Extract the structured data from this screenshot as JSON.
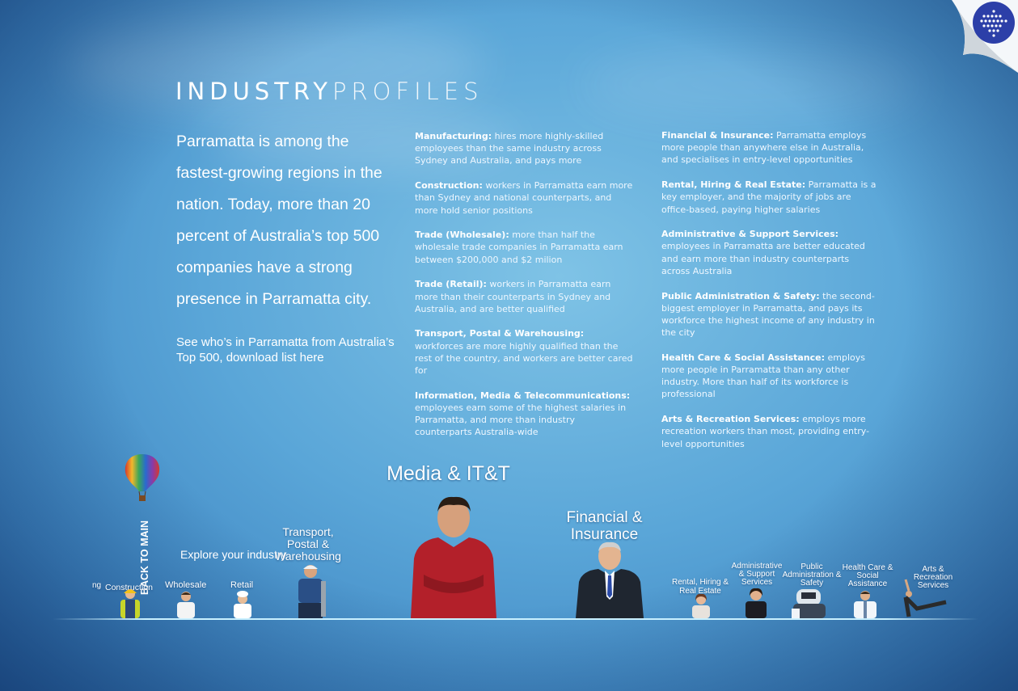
{
  "header": {
    "title_part1": "INDUSTRY",
    "title_part2": "PROFILES"
  },
  "intro": {
    "text": "Parramatta is among the fastest-growing regions in the nation. Today, more than 20 percent of Australia’s top 500 companies have a strong presence in Parramatta city.",
    "link_text": "See who’s in Parramatta from Australia’s Top 500, download list here"
  },
  "column1": [
    {
      "title": "Manufacturing:",
      "text": "hires more highly-skilled employees than the same industry across Sydney and Australia, and pays more"
    },
    {
      "title": "Construction:",
      "text": "workers in Parramatta earn more than Sydney and national counterparts, and more hold senior positions"
    },
    {
      "title": "Trade (Wholesale):",
      "text": "more than half the wholesale trade companies in Parramatta earn between $200,000 and $2 milion"
    },
    {
      "title": "Trade (Retail):",
      "text": "workers in Parramatta earn more than their counterparts in Sydney and Australia, and are better qualified"
    },
    {
      "title": "Transport, Postal & Warehousing:",
      "text": "workforces are more highly qualified than the rest of the country, and workers are better cared for"
    },
    {
      "title": "Information, Media & Telecommunications:",
      "text": "employees earn some of the highest salaries in Parramatta, and more than industry counterparts Australia-wide"
    }
  ],
  "column2": [
    {
      "title": "Financial & Insurance:",
      "text": "Parramatta employs more people than anywhere else in Australia, and specialises in entry-level opportunities"
    },
    {
      "title": "Rental, Hiring & Real Estate:",
      "text": "Parramatta is a key employer, and the majority of jobs are office-based, paying higher salaries"
    },
    {
      "title": "Administrative & Support Services:",
      "text": "employees in Parramatta are better educated and earn more than industry counterparts across Australia"
    },
    {
      "title": "Public Administration & Safety:",
      "text": "the second-biggest employer in Parramatta, and pays its workforce the highest income of any industry in the city"
    },
    {
      "title": "Health Care & Social Assistance:",
      "text": "employs more people in Parramatta than any other industry. More than half of its workforce is professional"
    },
    {
      "title": "Arts & Recreation Services:",
      "text": "employs more recreation workers than most, providing entry-level opportunities"
    }
  ],
  "nav": {
    "back_to_main": "BACK TO MAIN",
    "explore": "Explore your industry",
    "labels": {
      "manufacturing_partial": "ng",
      "construction": "Construction",
      "wholesale": "Wholesale",
      "retail": "Retail",
      "transport": "Transport, Postal & Warehousing",
      "media": "Media & IT&T",
      "financial": "Financial & Insurance",
      "rental": "Rental, Hiring & Real Estate",
      "admin": "Administrative & Support Services",
      "public": "Public Administration & Safety",
      "health": "Health Care & Social Assistance",
      "arts": "Arts & Recreation Services"
    }
  },
  "colors": {
    "sky_light": "#7fc3e6",
    "sky_dark": "#2d6aa8",
    "shirt_red": "#b3202a",
    "suit_dark": "#1f2630",
    "logo_blue": "#2c3fa8"
  },
  "icons": {
    "logo": "dotted-globe-logo",
    "balloon": "hot-air-balloon-icon"
  }
}
